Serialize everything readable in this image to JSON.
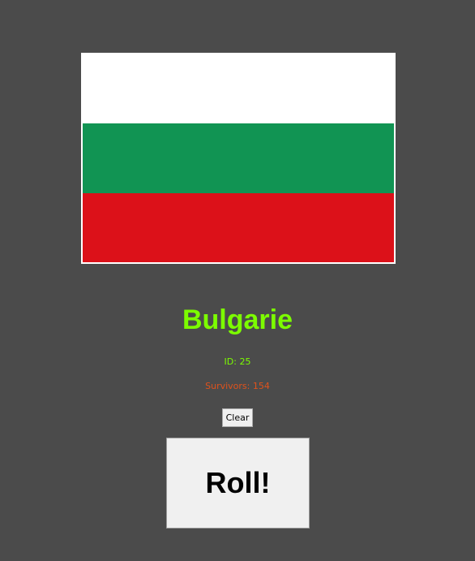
{
  "flag": {
    "country": "Bulgaria",
    "stripes": [
      {
        "name": "white",
        "color": "#ffffff"
      },
      {
        "name": "green",
        "color": "#119453"
      },
      {
        "name": "red",
        "color": "#dc1119"
      }
    ]
  },
  "result": {
    "country_name": "Bulgarie",
    "id_text": "ID: 25",
    "survivors_text": "Survivors: 154"
  },
  "controls": {
    "clear_label": "Clear",
    "roll_label": "Roll!"
  },
  "colors": {
    "background": "#4b4b4b",
    "name_color": "#7cfc00",
    "id_color": "#7cfc00",
    "survivors_color": "#e0521c"
  }
}
